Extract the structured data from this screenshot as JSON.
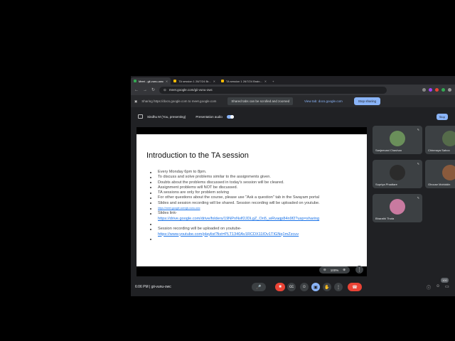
{
  "browser": {
    "tabs": [
      {
        "label": "Meet - gii-vunu-owc",
        "active": true
      },
      {
        "label": "TA session 1 26/7/24 Br..."
      },
      {
        "label": "TA session 1 26/7/24 Brain..."
      }
    ],
    "url": "meet.google.com/gii-vunu-owc"
  },
  "sharebar": {
    "text": "Sharing https://docs.google.com to meet.google.com",
    "scroll_btn": "Shared tabs can be scrolled and zoomed",
    "view_btn": "View tab: docs.google.com",
    "stop_btn": "Stop sharing"
  },
  "meetbar": {
    "presenter": "Sindhu M (You, presenting)",
    "audio_label": "Presentation audio",
    "stop_label": "Stop"
  },
  "slide": {
    "title": "Introduction to the TA session",
    "bullets": [
      "Every Monday 6pm to 8pm.",
      "To discuss and solve problems similar to the assignments given.",
      "Doubts about the problems discussed in today's session will be cleared.",
      "Assignment problems will NOT be discussed.",
      "TA sessions are only for problem solving",
      "For other questions about the course, please use \"Ask a question\" tab in the Swayam portal",
      "Slides and session recording will be shared. Session recording will be uploaded on youtube."
    ],
    "meet_link": "https://meet.google.com/gii-vunu-owc",
    "slides_label": "Slides link-",
    "slides_link": "https://drive.google.com/drive/folders/19NPnNvlf2JDLgZ_On5_wRvaqp84n9f2?usp=sharing",
    "recording_label": "Session recording will be uploaded on youtube-",
    "recording_link": "https://www.youtube.com/playlist?list=PLT1340Av1RCDX11lOv1TIGNq1mZzcuv",
    "zoom": "100%"
  },
  "participants": [
    {
      "name": "Sanjeevani Chavhan",
      "color": "#6a8f5a"
    },
    {
      "name": "Chinmaya Sahoo",
      "color": "#556b4a"
    },
    {
      "name": "Supriya Phadtare",
      "color": "#2b2b2b"
    },
    {
      "name": "Ghouse Mohiddin",
      "color": "#8a5a3c"
    },
    {
      "name": "Bharathi Thota",
      "color": "#c97aa0"
    }
  ],
  "controls": {
    "time": "6:06 PM",
    "meeting_code": "gii-vunu-owc",
    "badge": "100"
  }
}
